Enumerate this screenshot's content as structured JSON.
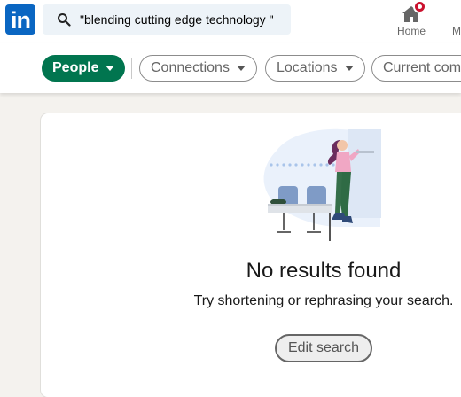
{
  "nav": {
    "logo_text": "in",
    "search_query": "\"blending cutting edge technology \"",
    "home_label": "Home",
    "more_label": "M"
  },
  "filters": {
    "people": "People",
    "connections": "Connections",
    "locations": "Locations",
    "current_company": "Current com"
  },
  "results": {
    "title": "No results found",
    "subtitle": "Try shortening or rephrasing your search.",
    "edit_button": "Edit search"
  },
  "colors": {
    "brand": "#0a66c2",
    "active_pill": "#01754f",
    "notification": "#cb112d"
  }
}
